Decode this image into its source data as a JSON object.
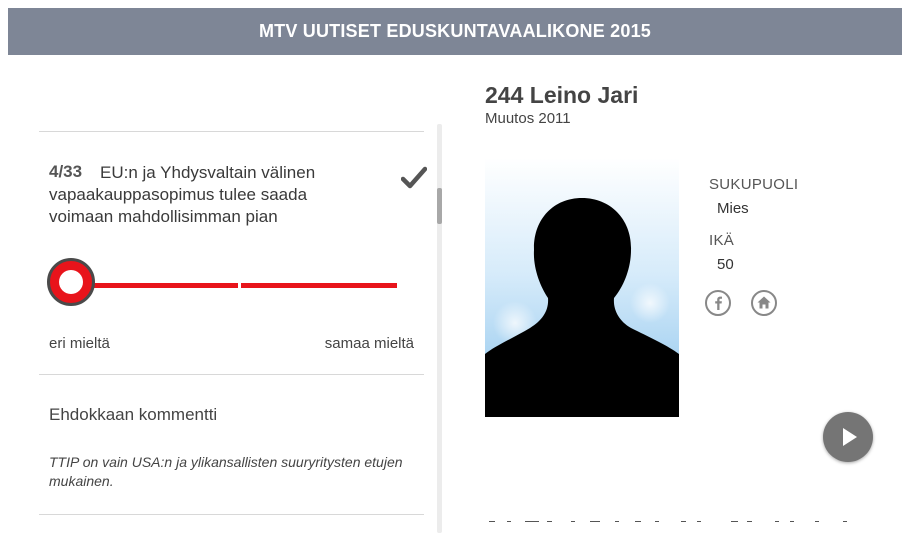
{
  "header": {
    "title": "MTV UUTISET EDUSKUNTAVAALIKONE 2015"
  },
  "question": {
    "number": "4/33",
    "text": "EU:n ja Yhdysvaltain välinen vapaakauppasopimus tulee saada voimaan mahdollisimman pian",
    "answer_level": 0
  },
  "scale": {
    "left_label": "eri mieltä",
    "right_label": "samaa mieltä"
  },
  "comment": {
    "title": "Ehdokkaan kommentti",
    "text": "TTIP on vain USA:n ja ylikansallisten suuryritysten etujen mukainen."
  },
  "candidate": {
    "name": "244 Leino Jari",
    "party": "Muutos 2011",
    "gender_label": "SUKUPUOLI",
    "gender": "Mies",
    "age_label": "IKÄ",
    "age": "50"
  },
  "icons": {
    "check": "check-icon",
    "facebook": "facebook-icon",
    "home": "home-icon",
    "play": "play-icon"
  },
  "colors": {
    "header_bg": "#7e8696",
    "accent_red": "#e8141b",
    "play_bg": "#757575"
  }
}
